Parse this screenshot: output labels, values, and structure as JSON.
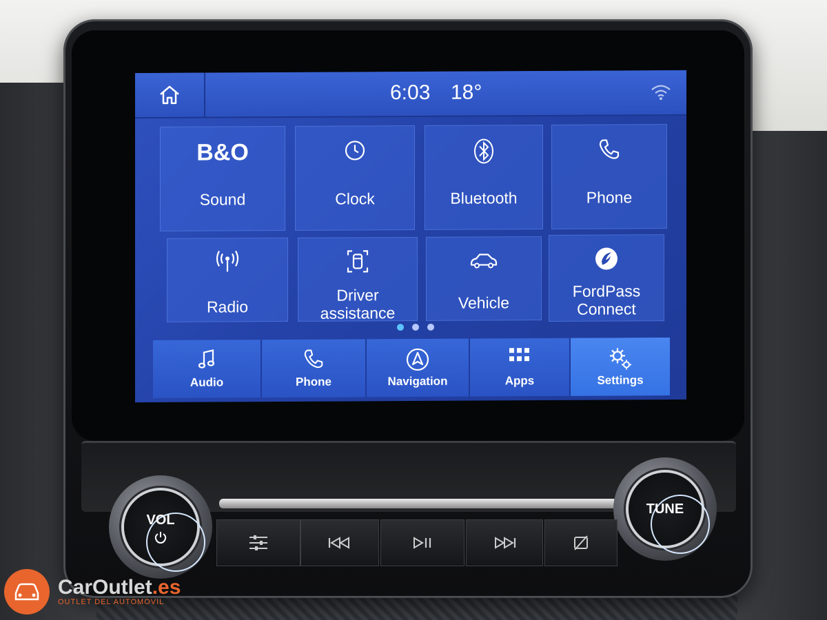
{
  "status": {
    "time": "6:03",
    "temperature": "18°"
  },
  "tiles": [
    {
      "label": "Sound",
      "icon": "bo-sound-icon"
    },
    {
      "label": "Clock",
      "icon": "clock-icon"
    },
    {
      "label": "Bluetooth",
      "icon": "bluetooth-icon"
    },
    {
      "label": "Phone",
      "icon": "phone-icon"
    },
    {
      "label": "Radio",
      "icon": "radio-antenna-icon"
    },
    {
      "label1": "Driver",
      "label2": "assistance",
      "icon": "driver-assistance-icon"
    },
    {
      "label": "Vehicle",
      "icon": "car-icon"
    },
    {
      "label1": "FordPass",
      "label2": "Connect",
      "icon": "fordpass-icon"
    }
  ],
  "pager": {
    "pages": 3,
    "current": 1
  },
  "navbar": [
    {
      "label": "Audio",
      "icon": "music-note-icon"
    },
    {
      "label": "Phone",
      "icon": "phone-icon"
    },
    {
      "label": "Navigation",
      "icon": "compass-arrow-icon"
    },
    {
      "label": "Apps",
      "icon": "grid-icon"
    },
    {
      "label": "Settings",
      "icon": "gears-icon",
      "active": true
    }
  ],
  "hardware": {
    "vol_label": "VOL",
    "tune_label": "TUNE"
  },
  "watermark": {
    "brand": "CarOutlet",
    "tld": ".es",
    "tagline": "OUTLET DEL AUTOMOVIL"
  },
  "colors": {
    "screen_blue": "#2442a8",
    "accent_active": "#4a86f0",
    "dot_active": "#5ec3ff",
    "watermark_orange": "#e8652d"
  }
}
